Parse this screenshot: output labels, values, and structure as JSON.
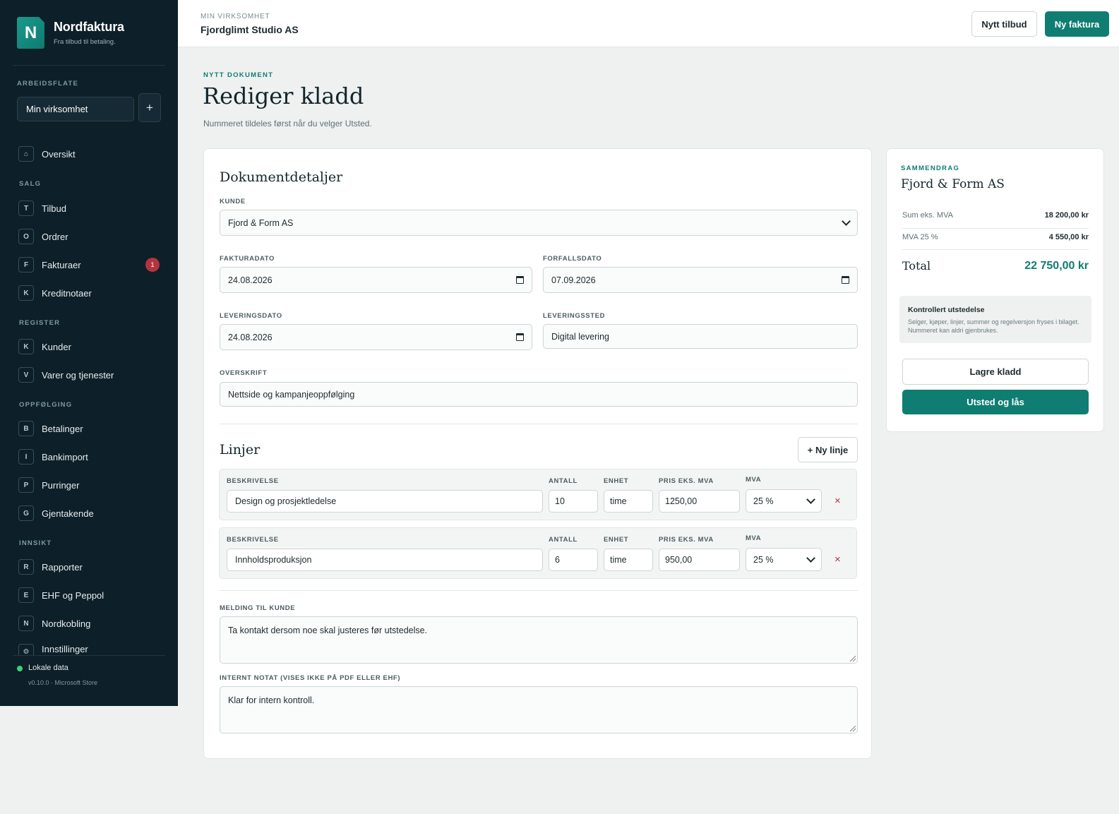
{
  "sidebar": {
    "brand": {
      "logo_letter": "N",
      "name": "Nordfaktura",
      "tagline": "Fra tilbud til betaling."
    },
    "workspace_section": "ARBEIDSFLATE",
    "workspace_value": "Min virksomhet",
    "workspace_add": "+",
    "nav": {
      "overview": {
        "key": "⌂",
        "label": "Oversikt"
      },
      "sales_heading": "SALG",
      "quotes": {
        "key": "T",
        "label": "Tilbud"
      },
      "orders": {
        "key": "O",
        "label": "Ordrer"
      },
      "invoices": {
        "key": "F",
        "label": "Fakturaer",
        "badge": "1"
      },
      "credit_notes": {
        "key": "K",
        "label": "Kreditnotaer"
      },
      "register_heading": "REGISTER",
      "customers": {
        "key": "K",
        "label": "Kunder"
      },
      "products": {
        "key": "V",
        "label": "Varer og tjenester"
      },
      "followup_heading": "OPPFØLGING",
      "payments": {
        "key": "B",
        "label": "Betalinger"
      },
      "bank_import": {
        "key": "I",
        "label": "Bankimport"
      },
      "reminders": {
        "key": "P",
        "label": "Purringer"
      },
      "recurring": {
        "key": "G",
        "label": "Gjentakende"
      },
      "insight_heading": "INNSIKT",
      "reports": {
        "key": "R",
        "label": "Rapporter"
      },
      "ehf": {
        "key": "E",
        "label": "EHF og Peppol"
      },
      "nordkobling": {
        "key": "N",
        "label": "Nordkobling"
      },
      "settings": {
        "key": "⚙",
        "label": "Innstillinger"
      }
    },
    "footer": {
      "status": "Lokale data",
      "version": "v0.10.0 · Microsoft Store"
    }
  },
  "topbar": {
    "kicker": "MIN VIRKSOMHET",
    "company": "Fjordglimt Studio AS",
    "new_quote": "Nytt tilbud",
    "new_invoice": "Ny faktura"
  },
  "page": {
    "kicker": "NYTT DOKUMENT",
    "title": "Rediger kladd",
    "subtitle": "Nummeret tildeles først når du velger Utsted."
  },
  "details": {
    "heading": "Dokumentdetaljer",
    "customer_label": "KUNDE",
    "customer_value": "Fjord & Form AS",
    "invoice_date_label": "FAKTURADATO",
    "invoice_date": "24.08.2026",
    "due_date_label": "FORFALLSDATO",
    "due_date": "07.09.2026",
    "delivery_date_label": "LEVERINGSDATO",
    "delivery_date": "24.08.2026",
    "delivery_place_label": "LEVERINGSSTED",
    "delivery_place": "Digital levering",
    "heading_label": "OVERSKRIFT",
    "heading_value": "Nettside og kampanjeoppfølging"
  },
  "lines": {
    "heading": "Linjer",
    "add_button": "+ Ny linje",
    "col_description": "BESKRIVELSE",
    "col_qty": "ANTALL",
    "col_unit": "ENHET",
    "col_price": "PRIS EKS. MVA",
    "col_vat": "MVA",
    "remove_glyph": "×",
    "rows": [
      {
        "description": "Design og prosjektledelse",
        "qty": "10",
        "unit": "time",
        "price": "1250,00",
        "vat": "25 %"
      },
      {
        "description": "Innholdsproduksjon",
        "qty": "6",
        "unit": "time",
        "price": "950,00",
        "vat": "25 %"
      }
    ]
  },
  "messages": {
    "customer_label": "MELDING TIL KUNDE",
    "customer_text": "Ta kontakt dersom noe skal justeres før utstedelse.",
    "internal_label": "INTERNT NOTAT (VISES IKKE PÅ PDF ELLER EHF)",
    "internal_text": "Klar for intern kontroll."
  },
  "summary": {
    "kicker": "SAMMENDRAG",
    "customer": "Fjord & Form AS",
    "net_label": "Sum eks. MVA",
    "net_value": "18 200,00 kr",
    "vat_label": "MVA 25 %",
    "vat_value": "4 550,00 kr",
    "total_label": "Total",
    "total_value": "22 750,00 kr",
    "notice_title": "Kontrollert utstedelse",
    "notice_text": "Selger, kjøper, linjer, summer og regelversjon fryses i bilaget. Nummeret kan aldri gjenbrukes.",
    "save_draft": "Lagre kladd",
    "issue_lock": "Utsted og lås"
  },
  "colors": {
    "accent": "#0f7d72",
    "sidebar": "#0d1f28",
    "danger": "#b3343f"
  }
}
